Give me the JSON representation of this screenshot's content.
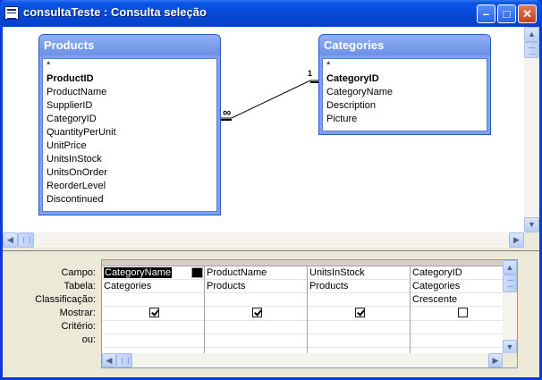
{
  "window": {
    "title": "consultaTeste : Consulta seleção",
    "minimize": "–",
    "maximize": "□",
    "close": "✕"
  },
  "tables": [
    {
      "name": "Products",
      "fields": [
        "*",
        "ProductID",
        "ProductName",
        "SupplierID",
        "CategoryID",
        "QuantityPerUnit",
        "UnitPrice",
        "UnitsInStock",
        "UnitsOnOrder",
        "ReorderLevel",
        "Discontinued"
      ],
      "primary_key": "ProductID"
    },
    {
      "name": "Categories",
      "fields": [
        "*",
        "CategoryID",
        "CategoryName",
        "Description",
        "Picture"
      ],
      "primary_key": "CategoryID"
    }
  ],
  "relationship": {
    "many_symbol": "∞",
    "one_symbol": "1"
  },
  "row_labels": [
    "Campo:",
    "Tabela:",
    "Classificação:",
    "Mostrar:",
    "Critério:",
    "ou:"
  ],
  "columns": [
    {
      "campo": "CategoryName",
      "tabela": "Categories",
      "classificacao": "",
      "mostrar": true
    },
    {
      "campo": "ProductName",
      "tabela": "Products",
      "classificacao": "",
      "mostrar": true
    },
    {
      "campo": "UnitsInStock",
      "tabela": "Products",
      "classificacao": "",
      "mostrar": true
    },
    {
      "campo": "CategoryID",
      "tabela": "Categories",
      "classificacao": "Crescente",
      "mostrar": false
    }
  ],
  "icons": {
    "app": "query-icon",
    "scroll_left": "◀",
    "scroll_right": "▶",
    "scroll_up": "▲",
    "scroll_down": "▼"
  }
}
